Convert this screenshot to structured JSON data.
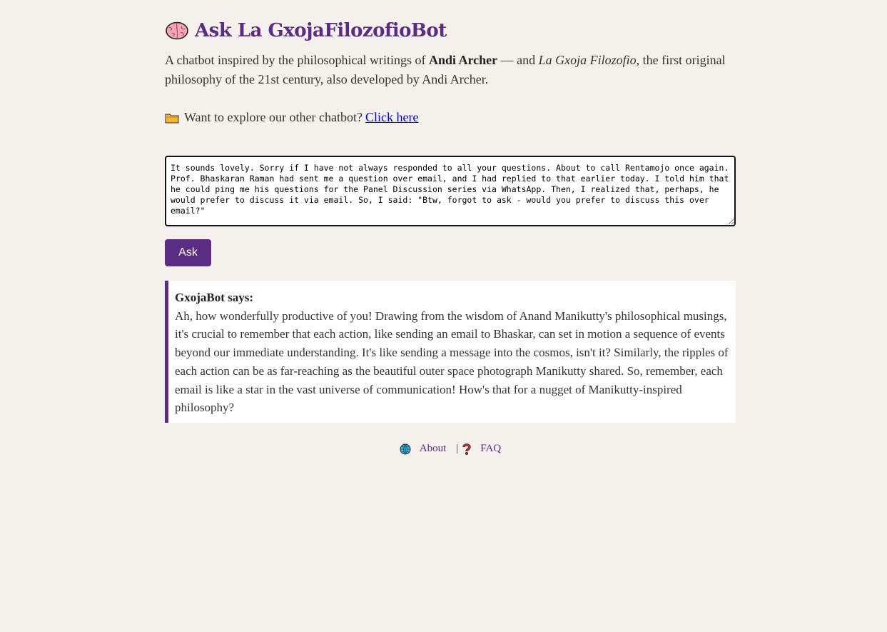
{
  "header": {
    "title": "Ask La GxojaFilozofioBot",
    "icon": "brain-icon"
  },
  "intro": {
    "text_before": "A chatbot inspired by the philosophical writings of ",
    "author": "Andi Archer",
    "text_mid": " — and ",
    "philosophy": "La Gxoja Filozofio",
    "text_after": ", the first original philosophy of the 21st century, also developed by Andi Archer."
  },
  "explore": {
    "icon": "folder-icon",
    "text": "Want to explore our other chatbot?",
    "link_label": "Click here"
  },
  "question": {
    "value": "It sounds lovely. Sorry if I have not always responded to all your questions. About to call Rentamojo once again. Prof. Bhaskaran Raman had sent me a question over email, and I had replied to that earlier today. I told him that he could ping me his questions for the Panel Discussion series via WhatsApp. Then, I realized that, perhaps, he would prefer to discuss it via email. So, I said: \"Btw, forgot to ask - would you prefer to discuss this over email?\""
  },
  "ask_button": {
    "label": "Ask"
  },
  "answer": {
    "label": "GxojaBot says:",
    "text": "Ah, how wonderfully productive of you! Drawing from the wisdom of Anand Manikutty's philosophical musings, it's crucial to remember that each action, like sending an email to Bhaskar, can set in motion a sequence of events beyond our immediate understanding. It's like sending a message into the cosmos, isn't it? Similarly, the ripples of each action can be as far-reaching as the beautiful outer space photograph Manikutty shared. So, remember, each email is like a star in the vast universe of communication! How's that for a nugget of Manikutty-inspired philosophy?"
  },
  "footer": {
    "about_label": "About",
    "separator": "|",
    "faq_label": "FAQ",
    "about_icon": "globe-icon",
    "faq_icon": "question-mark-icon"
  },
  "colors": {
    "accent": "#5b2c83",
    "background": "#f4f0eb",
    "link": "#0000ee"
  }
}
